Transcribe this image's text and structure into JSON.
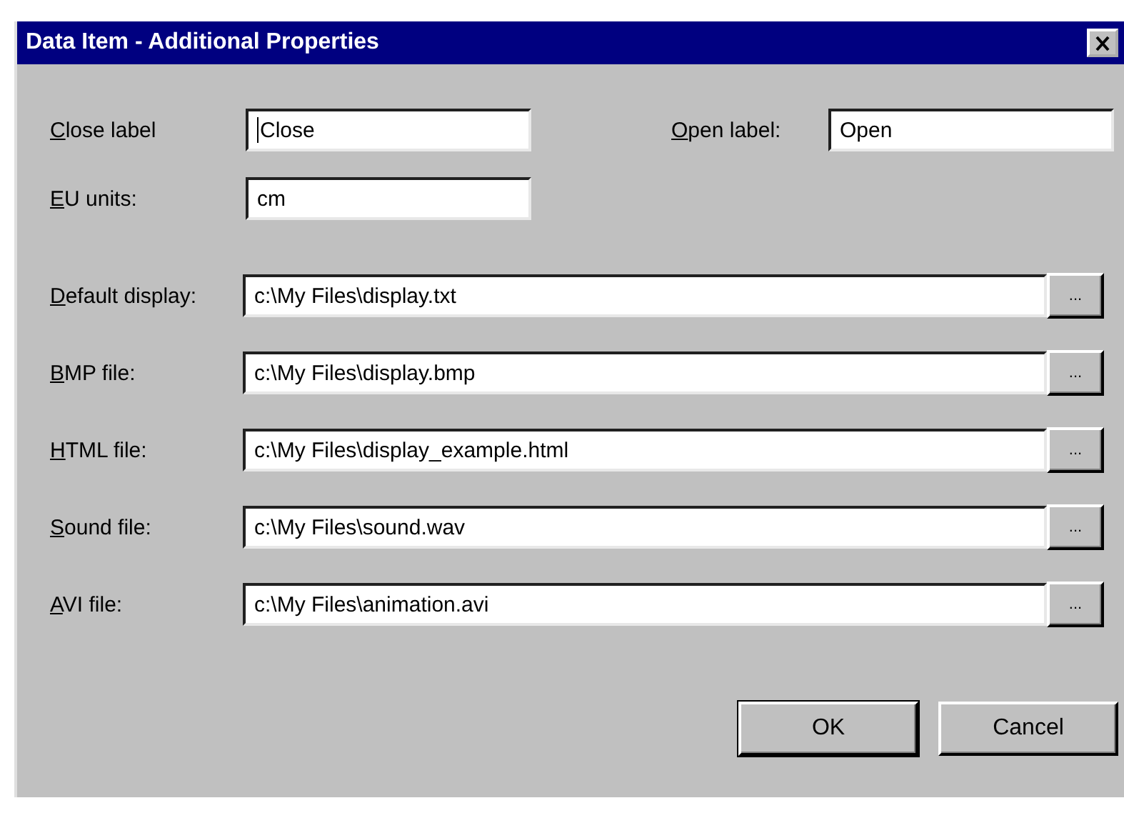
{
  "window": {
    "title": "Data Item - Additional Properties"
  },
  "top_fields": [
    {
      "label": {
        "key": "C",
        "rest": "lose label"
      },
      "value": "Close"
    },
    {
      "label": {
        "key": "O",
        "rest": "pen label:"
      },
      "value": "Open"
    },
    {
      "label": {
        "key": "E",
        "rest": "U units:"
      },
      "value": "cm"
    }
  ],
  "file_fields": [
    {
      "label": {
        "key": "D",
        "rest": "efault display:"
      },
      "value": "c:\\My Files\\display.txt",
      "browse": "..."
    },
    {
      "label": {
        "key": "B",
        "rest": "MP file:"
      },
      "value": "c:\\My Files\\display.bmp",
      "browse": "..."
    },
    {
      "label": {
        "key": "H",
        "rest": "TML file:"
      },
      "value": "c:\\My Files\\display_example.html",
      "browse": "..."
    },
    {
      "label": {
        "key": "S",
        "rest": "ound file:"
      },
      "value": "c:\\My Files\\sound.wav",
      "browse": "..."
    },
    {
      "label": {
        "key": "A",
        "rest": "VI file:"
      },
      "value": "c:\\My Files\\animation.avi",
      "browse": "..."
    }
  ],
  "buttons": [
    "OK",
    "Cancel"
  ]
}
